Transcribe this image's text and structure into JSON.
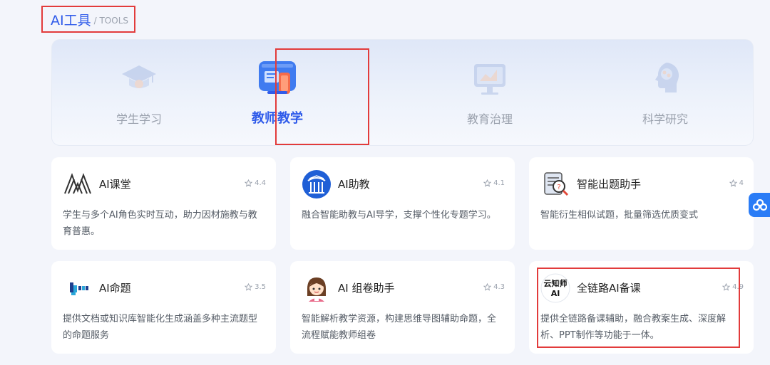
{
  "section": {
    "title": "AI工具",
    "subtitle": "/ TOOLS"
  },
  "tabs": [
    {
      "label": "学生学习",
      "active": false
    },
    {
      "label": "教师教学",
      "active": true
    },
    {
      "label": "教育治理",
      "active": false
    },
    {
      "label": "科学研究",
      "active": false
    }
  ],
  "tools": [
    {
      "name": "AI课堂",
      "rating": "4.4",
      "description": "学生与多个AI角色实时互动，助力因材施教与教育普惠。",
      "logo": "ai-classroom-logo"
    },
    {
      "name": "AI助教",
      "rating": "4.1",
      "description": "融合智能助教与AI导学，支撑个性化专题学习。",
      "logo": "ai-assistant-logo"
    },
    {
      "name": "智能出题助手",
      "rating": "4",
      "description": "智能衍生相似试题，批量筛选优质变式",
      "logo": "question-generator-logo"
    },
    {
      "name": "AI命题",
      "rating": "3.5",
      "description": "提供文档或知识库智能化生成涵盖多种主流题型的命题服务",
      "logo": "ai-proposition-logo"
    },
    {
      "name": "AI 组卷助手",
      "rating": "4.3",
      "description": "智能解析教学资源，构建思维导图辅助命题，全流程赋能教师组卷",
      "logo": "exam-assembly-avatar"
    },
    {
      "name": "全链路AI备课",
      "rating": "4.9",
      "description": "提供全链路备课辅助，融合教案生成、深度解析、PPT制作等功能于一体。",
      "logo": "yunzhishi-logo",
      "logo_text": [
        "云知师",
        "AI"
      ]
    }
  ],
  "colors": {
    "accent": "#2f5bea",
    "highlight": "#e23b3b",
    "float": "#2a7cf6"
  },
  "float_button": {
    "icon": "cloud-app-icon"
  }
}
